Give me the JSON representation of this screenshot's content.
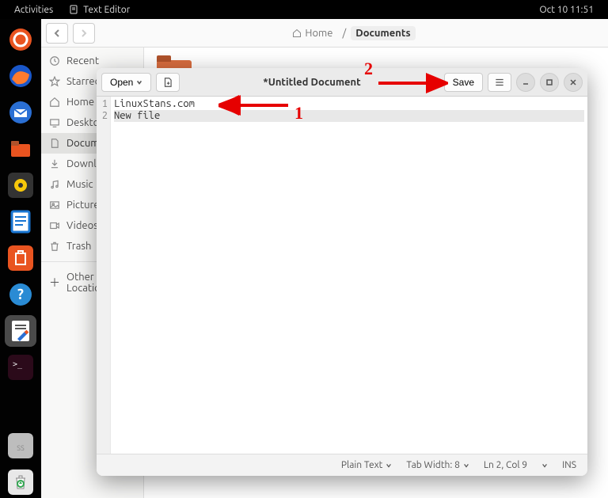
{
  "top_panel": {
    "activities": "Activities",
    "app_name": "Text Editor",
    "datetime": "Oct 10  11:51"
  },
  "files": {
    "breadcrumb": {
      "home": "Home",
      "documents": "Documents"
    },
    "sidebar": {
      "recent": "Recent",
      "starred": "Starred",
      "home": "Home",
      "desktop": "Desktop",
      "documents": "Documents",
      "downloads": "Downloads",
      "music": "Music",
      "pictures": "Pictures",
      "videos": "Videos",
      "trash": "Trash",
      "other": "Other Locations"
    }
  },
  "gedit": {
    "open_label": "Open",
    "title": "*Untitled Document",
    "save_label": "Save",
    "lines": {
      "1": "LinuxStans.com",
      "2": "New file"
    },
    "status": {
      "syntax": "Plain Text",
      "tab_width": "Tab Width: 8",
      "position": "Ln 2, Col 9",
      "mode": "INS"
    }
  },
  "annotations": {
    "label1": "1",
    "label2": "2"
  }
}
